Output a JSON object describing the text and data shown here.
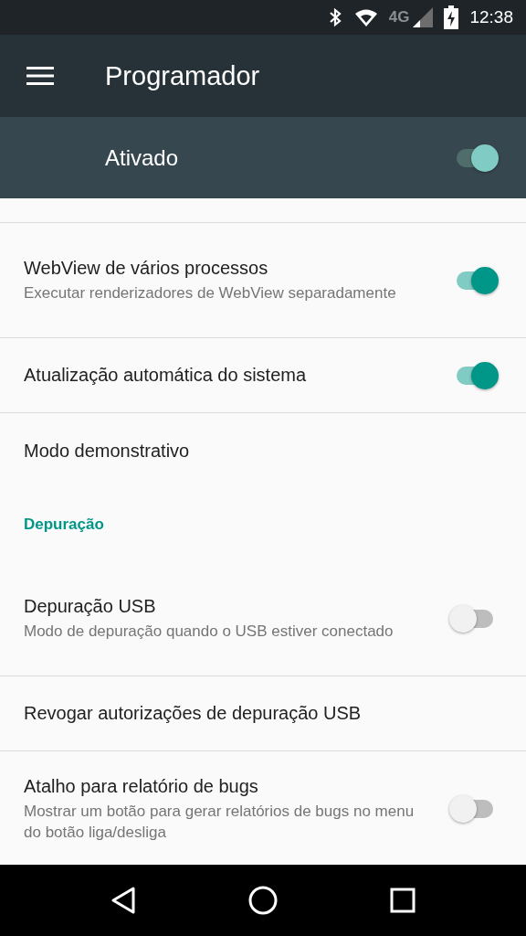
{
  "status_bar": {
    "network": "4G",
    "time": "12:38"
  },
  "app_bar": {
    "title": "Programador"
  },
  "master_switch": {
    "label": "Ativado",
    "on": true
  },
  "settings": [
    {
      "kind": "switch",
      "title": "WebView de vários processos",
      "summary": "Executar renderizadores de WebView separadamente",
      "on": true
    },
    {
      "kind": "switch",
      "title": "Atualização automática do sistema",
      "on": true
    },
    {
      "kind": "plain",
      "title": "Modo demonstrativo"
    },
    {
      "kind": "category",
      "title": "Depuração"
    },
    {
      "kind": "switch",
      "title": "Depuração USB",
      "summary": "Modo de depuração quando o USB estiver conectado",
      "on": false
    },
    {
      "kind": "plain",
      "title": "Revogar autorizações de depuração USB"
    },
    {
      "kind": "switch",
      "title": "Atalho para relatório de bugs",
      "summary": "Mostrar um botão para gerar relatórios de bugs no menu do botão liga/desliga",
      "on": false
    }
  ]
}
